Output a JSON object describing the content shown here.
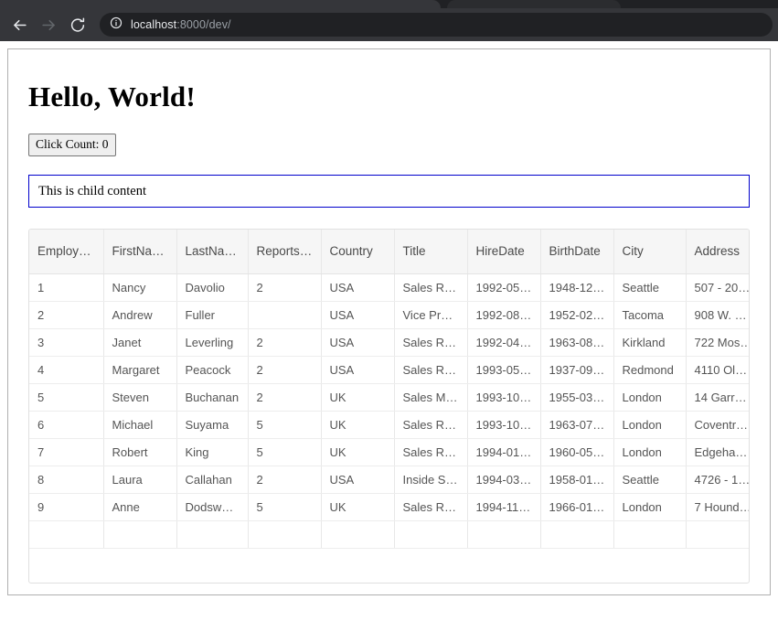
{
  "browser": {
    "back_icon": "back-arrow-icon",
    "forward_icon": "forward-arrow-icon",
    "reload_icon": "reload-icon",
    "site_info_icon": "info-circle-icon",
    "url_host": "localhost",
    "url_rest": ":8000/dev/"
  },
  "page": {
    "title": "Hello, World!",
    "click_button_label": "Click Count: 0",
    "child_content": "This is child content",
    "accent_border_color": "#0000cc"
  },
  "grid": {
    "columns": [
      "Employe…",
      "FirstName",
      "LastName",
      "ReportsTo",
      "Country",
      "Title",
      "HireDate",
      "BirthDate",
      "City",
      "Address"
    ],
    "rows": [
      [
        "1",
        "Nancy",
        "Davolio",
        "2",
        "USA",
        "Sales R…",
        "1992-05-…",
        "1948-12-…",
        "Seattle",
        "507 - 20t…"
      ],
      [
        "2",
        "Andrew",
        "Fuller",
        "",
        "USA",
        "Vice Pre…",
        "1992-08-…",
        "1952-02-…",
        "Tacoma",
        "908 W. …"
      ],
      [
        "3",
        "Janet",
        "Leverling",
        "2",
        "USA",
        "Sales R…",
        "1992-04-…",
        "1963-08-…",
        "Kirkland",
        "722 Mos…"
      ],
      [
        "4",
        "Margaret",
        "Peacock",
        "2",
        "USA",
        "Sales R…",
        "1993-05-…",
        "1937-09-…",
        "Redmond",
        "4110 Old…"
      ],
      [
        "5",
        "Steven",
        "Buchanan",
        "2",
        "UK",
        "Sales M…",
        "1993-10-…",
        "1955-03-…",
        "London",
        "14 Garre…"
      ],
      [
        "6",
        "Michael",
        "Suyama",
        "5",
        "UK",
        "Sales R…",
        "1993-10-…",
        "1963-07-…",
        "London",
        "Coventry…"
      ],
      [
        "7",
        "Robert",
        "King",
        "5",
        "UK",
        "Sales R…",
        "1994-01-…",
        "1960-05-…",
        "London",
        "Edgeha…"
      ],
      [
        "8",
        "Laura",
        "Callahan",
        "2",
        "USA",
        "Inside S…",
        "1994-03-…",
        "1958-01-…",
        "Seattle",
        "4726 - 1…"
      ],
      [
        "9",
        "Anne",
        "Dodsworth",
        "5",
        "UK",
        "Sales R…",
        "1994-11-…",
        "1966-01-…",
        "London",
        "7 Hound…"
      ]
    ]
  }
}
